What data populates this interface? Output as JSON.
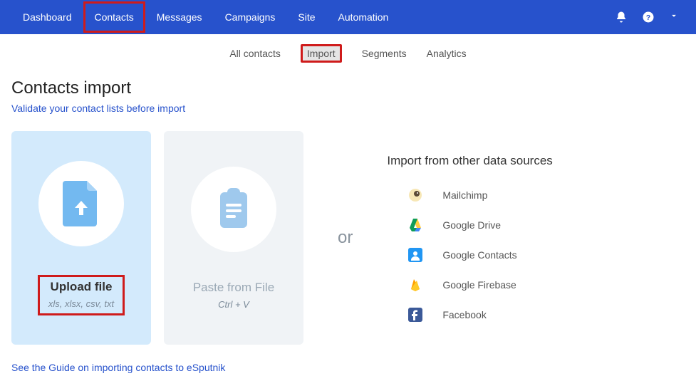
{
  "topnav": {
    "items": [
      "Dashboard",
      "Contacts",
      "Messages",
      "Campaigns",
      "Site",
      "Automation"
    ],
    "active_index": 1
  },
  "subnav": {
    "items": [
      "All contacts",
      "Import",
      "Segments",
      "Analytics"
    ],
    "active_index": 1
  },
  "page": {
    "title": "Contacts import",
    "validate_link": "Validate your contact lists before import",
    "guide_link": "See the Guide on importing contacts to eSputnik"
  },
  "cards": {
    "upload": {
      "title": "Upload file",
      "sub": "xls, xlsx, csv, txt"
    },
    "paste": {
      "title": "Paste from File",
      "sub": "Ctrl + V"
    }
  },
  "or_label": "or",
  "sources": {
    "title": "Import from other data sources",
    "items": [
      {
        "label": "Mailchimp",
        "icon": "mailchimp"
      },
      {
        "label": "Google Drive",
        "icon": "gdrive"
      },
      {
        "label": "Google Contacts",
        "icon": "gcontacts"
      },
      {
        "label": "Google Firebase",
        "icon": "firebase"
      },
      {
        "label": "Facebook",
        "icon": "facebook"
      }
    ]
  }
}
